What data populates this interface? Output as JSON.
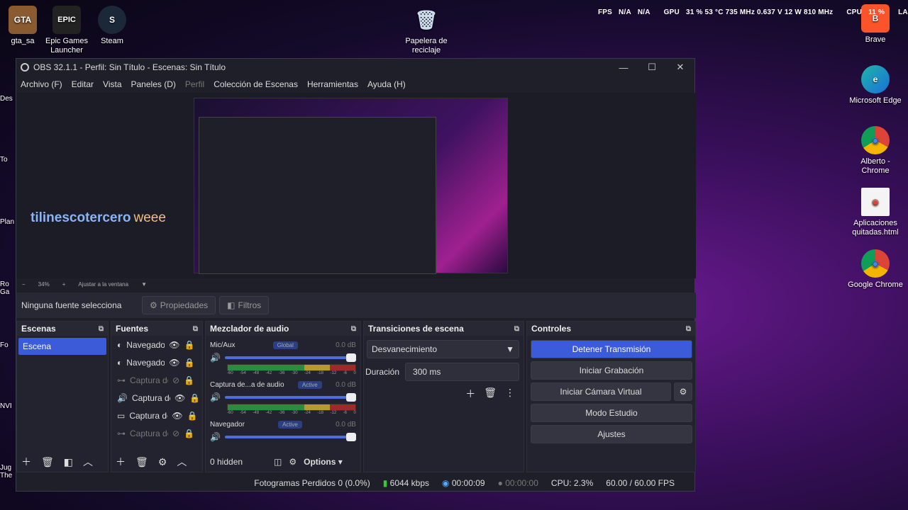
{
  "desktop": {
    "icons": [
      {
        "label": "gta_sa",
        "glyph": "GTA"
      },
      {
        "label": "Epic Games Launcher",
        "glyph": "EPIC"
      },
      {
        "label": "Steam",
        "glyph": "S"
      },
      {
        "label": "Papelera de reciclaje",
        "glyph": "🗑"
      },
      {
        "label": "Brave",
        "glyph": "B"
      },
      {
        "label": "Microsoft Edge",
        "glyph": "e"
      },
      {
        "label": "Alberto - Chrome",
        "glyph": "◉"
      },
      {
        "label": "Aplicaciones quitadas.html",
        "glyph": "◉"
      },
      {
        "label": "Google Chrome",
        "glyph": "◉"
      }
    ],
    "left_edge": [
      "Des",
      "To",
      "Plan",
      "Ro Ga",
      "Fo",
      "NVI",
      "Jug The"
    ],
    "hud": {
      "fps": "FPS",
      "fps_v1": "N/A",
      "fps_v2": "N/A",
      "gpu": "GPU",
      "gpu_v": "31 % 53 °C 735 MHz 0.637 V 12 W 810 MHz",
      "cpu": "CPU",
      "cpu_v": "11 %",
      "tail": "LA"
    }
  },
  "window": {
    "title": "OBS 32.1.1 - Perfil: Sin Título - Escenas: Sin Título",
    "menu": [
      "Archivo (F)",
      "Editar",
      "Vista",
      "Paneles (D)",
      "Perfil",
      "Colección de Escenas",
      "Herramientas",
      "Ayuda (H)"
    ],
    "preview_overlay": {
      "name": "tilinescotercero",
      "suffix": "weee"
    },
    "zoom": {
      "minus": "−",
      "value": "34%",
      "plus": "+",
      "fit": "Ajustar a la ventana"
    },
    "source_bar": {
      "label": "Ninguna fuente selecciona",
      "props": "Propiedades",
      "filters": "Filtros"
    }
  },
  "docks": {
    "scenes": {
      "title": "Escenas",
      "items": [
        "Escena"
      ]
    },
    "sources": {
      "title": "Fuentes",
      "items": [
        {
          "name": "Navegado",
          "hidden": false
        },
        {
          "name": "Navegado",
          "hidden": false
        },
        {
          "name": "Captura de",
          "hidden": true
        },
        {
          "name": "Captura de",
          "hidden": false
        },
        {
          "name": "Captura de",
          "hidden": false
        },
        {
          "name": "Captura de",
          "hidden": true
        }
      ]
    },
    "mixer": {
      "title": "Mezclador de audio",
      "channels": [
        {
          "name": "Mic/Aux",
          "badge": "Global",
          "db": "0.0 dB"
        },
        {
          "name": "Captura de...a de audio",
          "badge": "Active",
          "db": "0.0 dB"
        },
        {
          "name": "Navegador",
          "badge": "Active",
          "db": "0.0 dB"
        }
      ],
      "ticks": [
        "-60",
        "-54",
        "-48",
        "-42",
        "-36",
        "-30",
        "-24",
        "-18",
        "-12",
        "-6",
        "0"
      ],
      "hidden": "0 hidden",
      "options": "Options"
    },
    "transitions": {
      "title": "Transiciones de escena",
      "type": "Desvanecimiento",
      "duration_label": "Duración",
      "duration": "300 ms"
    },
    "controls": {
      "title": "Controles",
      "buttons": [
        "Detener Transmisión",
        "Iniciar Grabación",
        "Iniciar Cámara Virtual",
        "Modo Estudio",
        "Ajustes"
      ]
    }
  },
  "status": {
    "dropped": "Fotogramas Perdidos 0 (0.0%)",
    "bitrate": "6044 kbps",
    "stream_time": "00:00:09",
    "rec_time": "00:00:00",
    "cpu": "CPU: 2.3%",
    "fps": "60.00 / 60.00 FPS"
  }
}
